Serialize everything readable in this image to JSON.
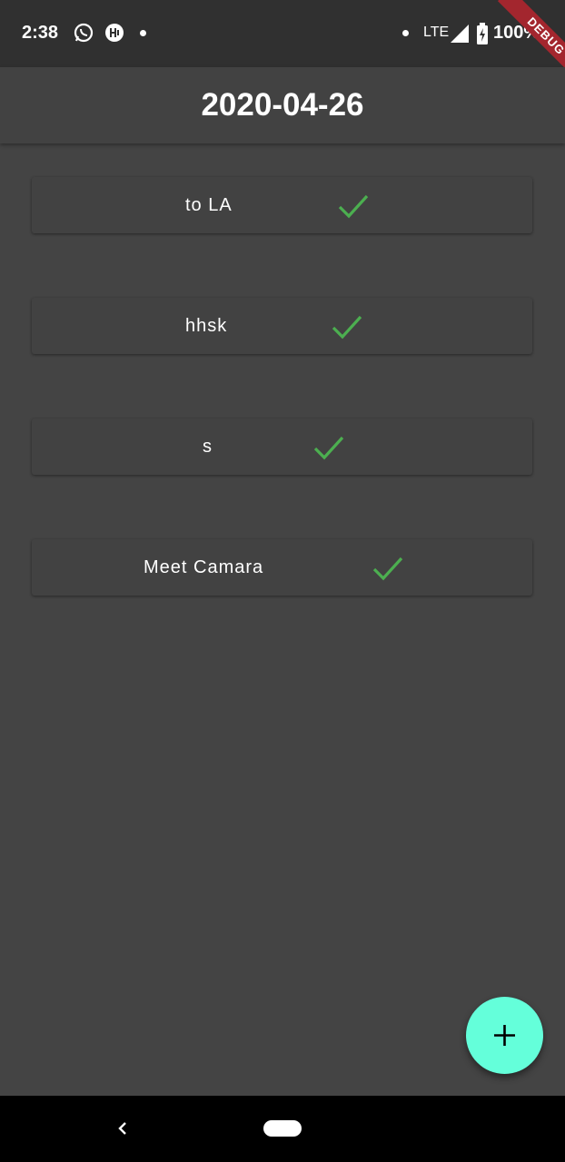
{
  "status_bar": {
    "time": "2:38",
    "network": "LTE",
    "battery": "100%",
    "icons": [
      "whatsapp-icon",
      "app-notification-icon",
      "notification-dot",
      "signal-icon",
      "battery-charging-icon"
    ]
  },
  "debug_banner": "DEBUG",
  "app_bar": {
    "title": "2020-04-26"
  },
  "tasks": [
    {
      "title": "to LA",
      "done": true
    },
    {
      "title": "hhsk",
      "done": true
    },
    {
      "title": "s",
      "done": true
    },
    {
      "title": "Meet Camara",
      "done": true
    }
  ],
  "colors": {
    "background": "#444444",
    "status_bar": "#303030",
    "card": "#424242",
    "check": "#4caf50",
    "fab": "#64ffda",
    "debug_banner": "#a3262e"
  },
  "fab": {
    "icon": "plus-icon"
  },
  "nav_bar": {
    "icons": [
      "back-icon",
      "home-pill-icon"
    ]
  }
}
